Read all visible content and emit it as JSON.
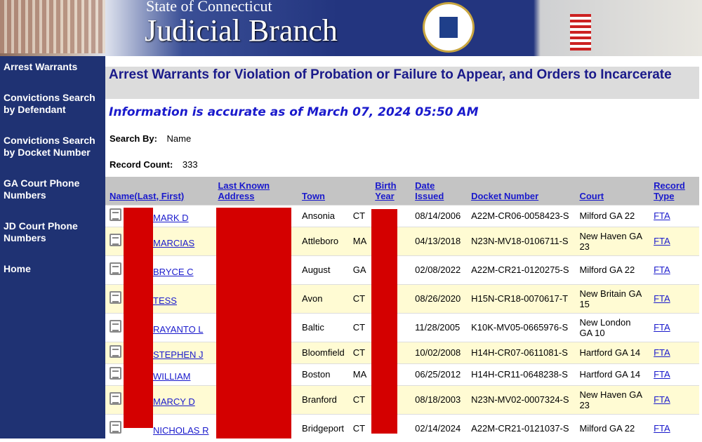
{
  "header": {
    "state": "State of Connecticut",
    "branch": "Judicial Branch"
  },
  "sidebar": {
    "items": [
      {
        "label": "Arrest Warrants"
      },
      {
        "label": "Convictions Search by Defendant"
      },
      {
        "label": "Convictions Search by Docket Number"
      },
      {
        "label": "GA Court Phone Numbers"
      },
      {
        "label": "JD Court Phone Numbers"
      },
      {
        "label": "Home"
      }
    ]
  },
  "main": {
    "title": "Arrest Warrants for Violation of Probation or Failure to Appear, and Orders to Incarcerate",
    "accuracy": "Information is accurate as of March 07, 2024 05:50 AM",
    "search_by_label": "Search By:",
    "search_by_value": "Name",
    "record_count_label": "Record Count:",
    "record_count_value": "333",
    "columns": [
      "Name(Last, First)",
      "Last Known Address",
      "Town",
      "",
      "Birth Year",
      "Date Issued",
      "Docket Number",
      "Court",
      "Record Type"
    ],
    "rows": [
      {
        "name": "MARK D",
        "town": "Ansonia",
        "state": "CT",
        "date": "08/14/2006",
        "docket": "A22M-CR06-0058423-S",
        "court": "Milford GA 22",
        "type": "FTA"
      },
      {
        "name": "MARCIAS",
        "town": "Attleboro",
        "state": "MA",
        "date": "04/13/2018",
        "docket": "N23N-MV18-0106711-S",
        "court": "New Haven GA 23",
        "type": "FTA"
      },
      {
        "name": "BRYCE C",
        "town": "August",
        "state": "GA",
        "date": "02/08/2022",
        "docket": "A22M-CR21-0120275-S",
        "court": "Milford GA 22",
        "type": "FTA"
      },
      {
        "name": "TESS",
        "town": "Avon",
        "state": "CT",
        "date": "08/26/2020",
        "docket": "H15N-CR18-0070617-T",
        "court": "New Britain GA 15",
        "type": "FTA"
      },
      {
        "name": "RAYANTO L",
        "town": "Baltic",
        "state": "CT",
        "date": "11/28/2005",
        "docket": "K10K-MV05-0665976-S",
        "court": "New London GA 10",
        "type": "FTA"
      },
      {
        "name": "STEPHEN J",
        "town": "Bloomfield",
        "state": "CT",
        "date": "10/02/2008",
        "docket": "H14H-CR07-0611081-S",
        "court": "Hartford GA 14",
        "type": "FTA"
      },
      {
        "name": "WILLIAM",
        "town": "Boston",
        "state": "MA",
        "date": "06/25/2012",
        "docket": "H14H-CR11-0648238-S",
        "court": "Hartford GA 14",
        "type": "FTA"
      },
      {
        "name": "MARCY D",
        "town": "Branford",
        "state": "CT",
        "date": "08/18/2003",
        "docket": "N23N-MV02-0007324-S",
        "court": "New Haven GA 23",
        "type": "FTA"
      },
      {
        "name": "NICHOLAS R",
        "town": "Bridgeport",
        "state": "CT",
        "date": "02/14/2024",
        "docket": "A22M-CR21-0121037-S",
        "court": "Milford GA 22",
        "type": "FTA"
      }
    ]
  },
  "colors": {
    "navy": "#1f3273",
    "link": "#1a1acc",
    "redaction": "#d40000",
    "row_alt": "#fffbd3"
  }
}
